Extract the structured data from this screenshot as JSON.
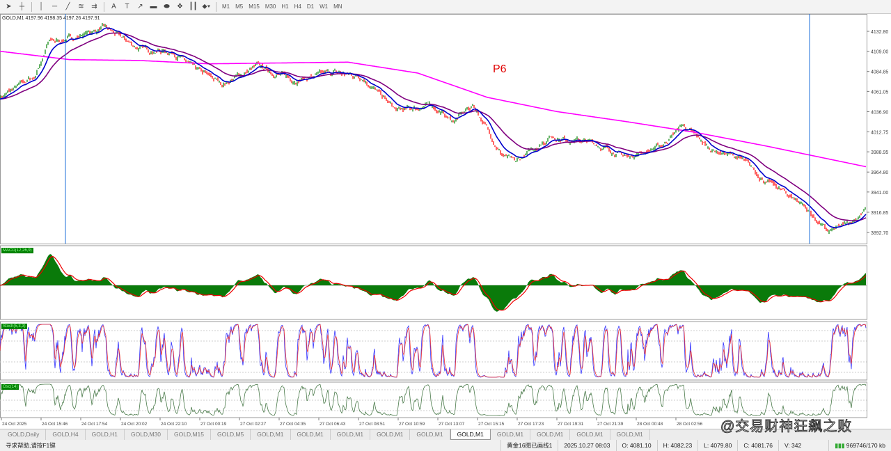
{
  "toolbar": {
    "icons": [
      "cursor-icon",
      "crosshair-icon",
      "vertical-line-icon",
      "horizontal-line-icon",
      "trendline-icon",
      "fibonacci-icon",
      "channel-icon",
      "text-icon",
      "label-icon",
      "arrow-icon",
      "rectangle-icon",
      "ellipse-icon",
      "grid-icon",
      "period-separator-icon",
      "shapes-dropdown-icon"
    ],
    "text_tool": "A",
    "timeframes": [
      "M1",
      "M5",
      "M15",
      "M30",
      "H1",
      "H4",
      "D1",
      "W1",
      "MN"
    ]
  },
  "chart": {
    "header": "GOLD,M1  4197.96 4198.35 4197.26 4197.91",
    "annotation": "P6",
    "price_labels": [
      "4132.80",
      "4109.00",
      "4084.85",
      "4061.05",
      "4036.90",
      "4012.75",
      "3988.95",
      "3964.80",
      "3941.00",
      "3916.85",
      "3892.70"
    ],
    "time_labels": [
      "24 Oct 2025",
      "24 Oct 15:46",
      "24 Oct 17:54",
      "24 Oct 20:02",
      "24 Oct 22:10",
      "27 Oct 00:19",
      "27 Oct 02:27",
      "27 Oct 04:35",
      "27 Oct 06:43",
      "27 Oct 08:51",
      "27 Oct 10:59",
      "27 Oct 13:07",
      "27 Oct 15:15",
      "27 Oct 17:23",
      "27 Oct 19:31",
      "27 Oct 21:39",
      "28 Oct 00:48",
      "28 Oct 02:56"
    ],
    "colors": {
      "ma_slow": "#ff00ff",
      "ma_mid": "#800080",
      "ma_fast": "#0000cc",
      "bull": "#008000",
      "bear": "#ff0000",
      "separator": "#1e6fd9"
    }
  },
  "chart_data": {
    "type": "line",
    "symbol": "GOLD",
    "timeframe": "M1",
    "ylim": [
      3880,
      4155
    ],
    "price_keypoints": [
      [
        0,
        4054
      ],
      [
        50,
        4079
      ],
      [
        70,
        4120
      ],
      [
        100,
        4124
      ],
      [
        150,
        4137
      ],
      [
        200,
        4112
      ],
      [
        250,
        4108
      ],
      [
        280,
        4087
      ],
      [
        320,
        4070
      ],
      [
        370,
        4091
      ],
      [
        420,
        4075
      ],
      [
        480,
        4083
      ],
      [
        520,
        4079
      ],
      [
        570,
        4037
      ],
      [
        620,
        4045
      ],
      [
        650,
        4025
      ],
      [
        680,
        4045
      ],
      [
        720,
        3987
      ],
      [
        740,
        3975
      ],
      [
        790,
        4008
      ],
      [
        850,
        4000
      ],
      [
        900,
        3983
      ],
      [
        950,
        3996
      ],
      [
        980,
        4021
      ],
      [
        1020,
        3992
      ],
      [
        1060,
        3983
      ],
      [
        1100,
        3954
      ],
      [
        1150,
        3929
      ],
      [
        1190,
        3892
      ],
      [
        1220,
        3904
      ],
      [
        1245,
        3921
      ]
    ],
    "ma_slow_keypoints": [
      [
        0,
        4109
      ],
      [
        100,
        4099
      ],
      [
        200,
        4098
      ],
      [
        300,
        4094
      ],
      [
        500,
        4096
      ],
      [
        600,
        4083
      ],
      [
        700,
        4054
      ],
      [
        800,
        4037
      ],
      [
        900,
        4025
      ],
      [
        1000,
        4012
      ],
      [
        1100,
        3996
      ],
      [
        1245,
        3971
      ]
    ],
    "separators_bar": [
      94,
      1163
    ]
  },
  "subwindows": [
    {
      "label": "MACD(12,26,9)"
    },
    {
      "label": "Stoch(5,3,3)"
    },
    {
      "label": "Osc(14)"
    }
  ],
  "tabs": [
    "GOLD,Daily",
    "GOLD,H4",
    "GOLD,H1",
    "GOLD,M30",
    "GOLD,M15",
    "GOLD,M5",
    "GOLD,M1",
    "GOLD,M1",
    "GOLD,M1",
    "GOLD,M1",
    "GOLD,M1",
    "GOLD,M1",
    "GOLD,M1",
    "GOLD,M1",
    "GOLD,M1",
    "GOLD,M1"
  ],
  "active_tab": 11,
  "status": {
    "help": "寻求帮助,请按F1键",
    "profile": "黄金16图已画线1",
    "datetime": "2025.10.27 08:03",
    "open": "O: 4081.10",
    "high": "H: 4082.23",
    "low": "L: 4079.80",
    "close": "C: 4081.76",
    "volume": "V: 342",
    "traffic": "969746/170 kb"
  },
  "watermark": "@交易财神狂飙之败"
}
